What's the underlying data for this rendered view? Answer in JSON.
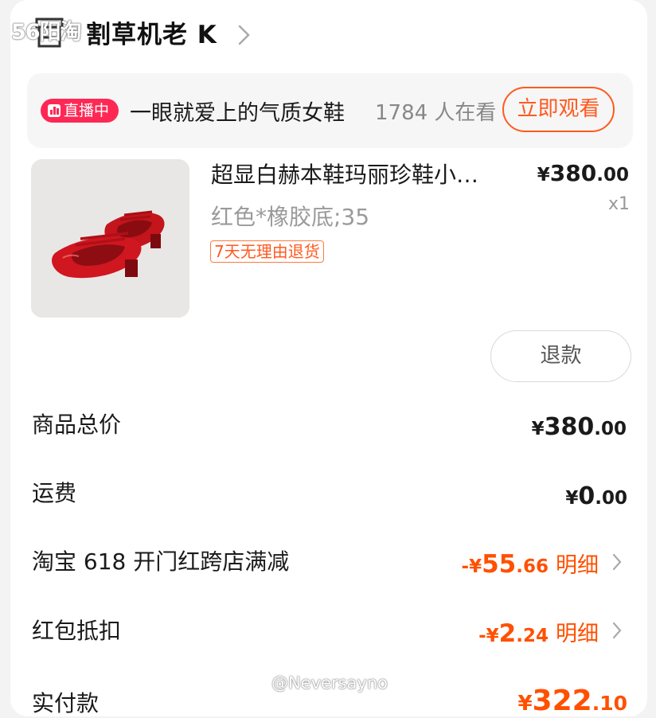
{
  "overlay": {
    "corner_mark": "56阳淘"
  },
  "shop": {
    "name": "割草机老 K",
    "icon": "store-icon"
  },
  "live": {
    "badge": "直播中",
    "title": "一眼就爱上的气质女鞋",
    "viewers": "1784 人在看",
    "watch_button": "立即观看",
    "badge_color": "#ff2855"
  },
  "product": {
    "title": "超显白赫本鞋玛丽珍鞋小…",
    "sku": "红色*橡胶底;35",
    "tag": "7天无理由退货",
    "price": {
      "symbol": "¥",
      "integer": "380",
      "decimal": ".00"
    },
    "quantity": "x1",
    "image": "red-mary-jane-shoes"
  },
  "refund_button": "退款",
  "summary": {
    "goods_total": {
      "label": "商品总价",
      "symbol": "¥",
      "integer": "380",
      "decimal": ".00"
    },
    "shipping": {
      "label": "运费",
      "symbol": "¥",
      "integer": "0",
      "decimal": ".00"
    },
    "discount_618": {
      "label": "淘宝 618 开门红跨店满减",
      "symbol": "-¥",
      "integer": "55",
      "decimal": ".66",
      "detail": "明细"
    },
    "red_packet": {
      "label": "红包抵扣",
      "symbol": "-¥",
      "integer": "2",
      "decimal": ".24",
      "detail": "明细"
    },
    "paid": {
      "label": "实付款",
      "symbol": "¥",
      "integer": "322",
      "decimal": ".10"
    }
  },
  "watermark": "@Neversayno",
  "colors": {
    "accent": "#ff5000",
    "text": "#1a1a1a",
    "muted": "#999999"
  }
}
